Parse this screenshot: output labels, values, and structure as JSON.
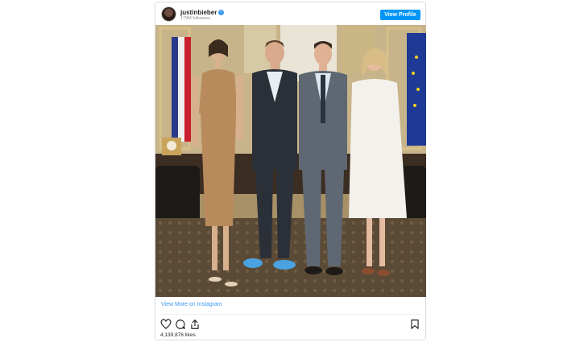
{
  "header": {
    "username": "justinbieber",
    "followers": "179M followers",
    "view_profile_label": "View Profile"
  },
  "post": {
    "view_more_label": "View More on Instagram",
    "likes": "4,139,876 likes"
  },
  "icons": {
    "like": "heart-icon",
    "comment": "comment-icon",
    "share": "share-icon",
    "save": "bookmark-icon"
  },
  "colors": {
    "accent": "#0095f6",
    "link": "#3897f0",
    "text": "#262626",
    "muted": "#8e8e8e"
  }
}
